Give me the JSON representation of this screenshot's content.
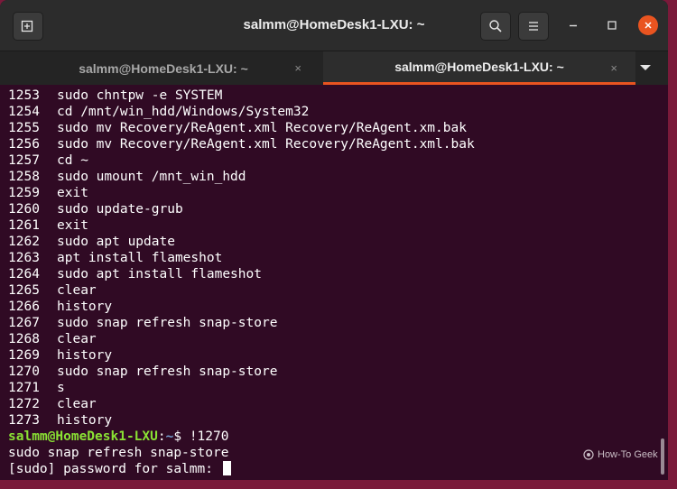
{
  "window": {
    "title": "salmm@HomeDesk1-LXU: ~",
    "icons": {
      "new_tab": "new-tab-icon",
      "search": "search-icon",
      "menu": "hamburger-menu-icon",
      "minimize": "minimize-icon",
      "maximize": "maximize-icon",
      "close": "close-icon"
    },
    "close_color": "#e95420"
  },
  "tabs": [
    {
      "label": "salmm@HomeDesk1-LXU: ~",
      "active": false,
      "close": "×"
    },
    {
      "label": "salmm@HomeDesk1-LXU: ~",
      "active": true,
      "close": "×"
    }
  ],
  "terminal": {
    "history": [
      {
        "num": "1253",
        "cmd": "sudo chntpw -e SYSTEM"
      },
      {
        "num": "1254",
        "cmd": "cd /mnt/win_hdd/Windows/System32"
      },
      {
        "num": "1255",
        "cmd": "sudo mv Recovery/ReAgent.xml Recovery/ReAgent.xm.bak"
      },
      {
        "num": "1256",
        "cmd": "sudo mv Recovery/ReAgent.xml Recovery/ReAgent.xml.bak"
      },
      {
        "num": "1257",
        "cmd": "cd ~"
      },
      {
        "num": "1258",
        "cmd": "sudo umount /mnt_win_hdd"
      },
      {
        "num": "1259",
        "cmd": "exit"
      },
      {
        "num": "1260",
        "cmd": "sudo update-grub"
      },
      {
        "num": "1261",
        "cmd": "exit"
      },
      {
        "num": "1262",
        "cmd": "sudo apt update"
      },
      {
        "num": "1263",
        "cmd": "apt install flameshot"
      },
      {
        "num": "1264",
        "cmd": "sudo apt install flameshot"
      },
      {
        "num": "1265",
        "cmd": "clear"
      },
      {
        "num": "1266",
        "cmd": "history"
      },
      {
        "num": "1267",
        "cmd": "sudo snap refresh snap-store"
      },
      {
        "num": "1268",
        "cmd": "clear"
      },
      {
        "num": "1269",
        "cmd": "history"
      },
      {
        "num": "1270",
        "cmd": "sudo snap refresh snap-store"
      },
      {
        "num": "1271",
        "cmd": "s"
      },
      {
        "num": "1272",
        "cmd": "clear"
      },
      {
        "num": "1273",
        "cmd": "history"
      }
    ],
    "prompt": {
      "user_host": "salmm@HomeDesk1-LXU",
      "separator": ":",
      "path": "~",
      "symbol": "$ ",
      "command": "!1270"
    },
    "output_line": "sudo snap refresh snap-store",
    "password_prompt": "[sudo] password for salmm: ",
    "colors": {
      "background": "#300a24",
      "user_host": "#8ae234",
      "path": "#729fcf",
      "text": "#ffffff"
    }
  },
  "watermark": {
    "text": "How-To Geek"
  }
}
